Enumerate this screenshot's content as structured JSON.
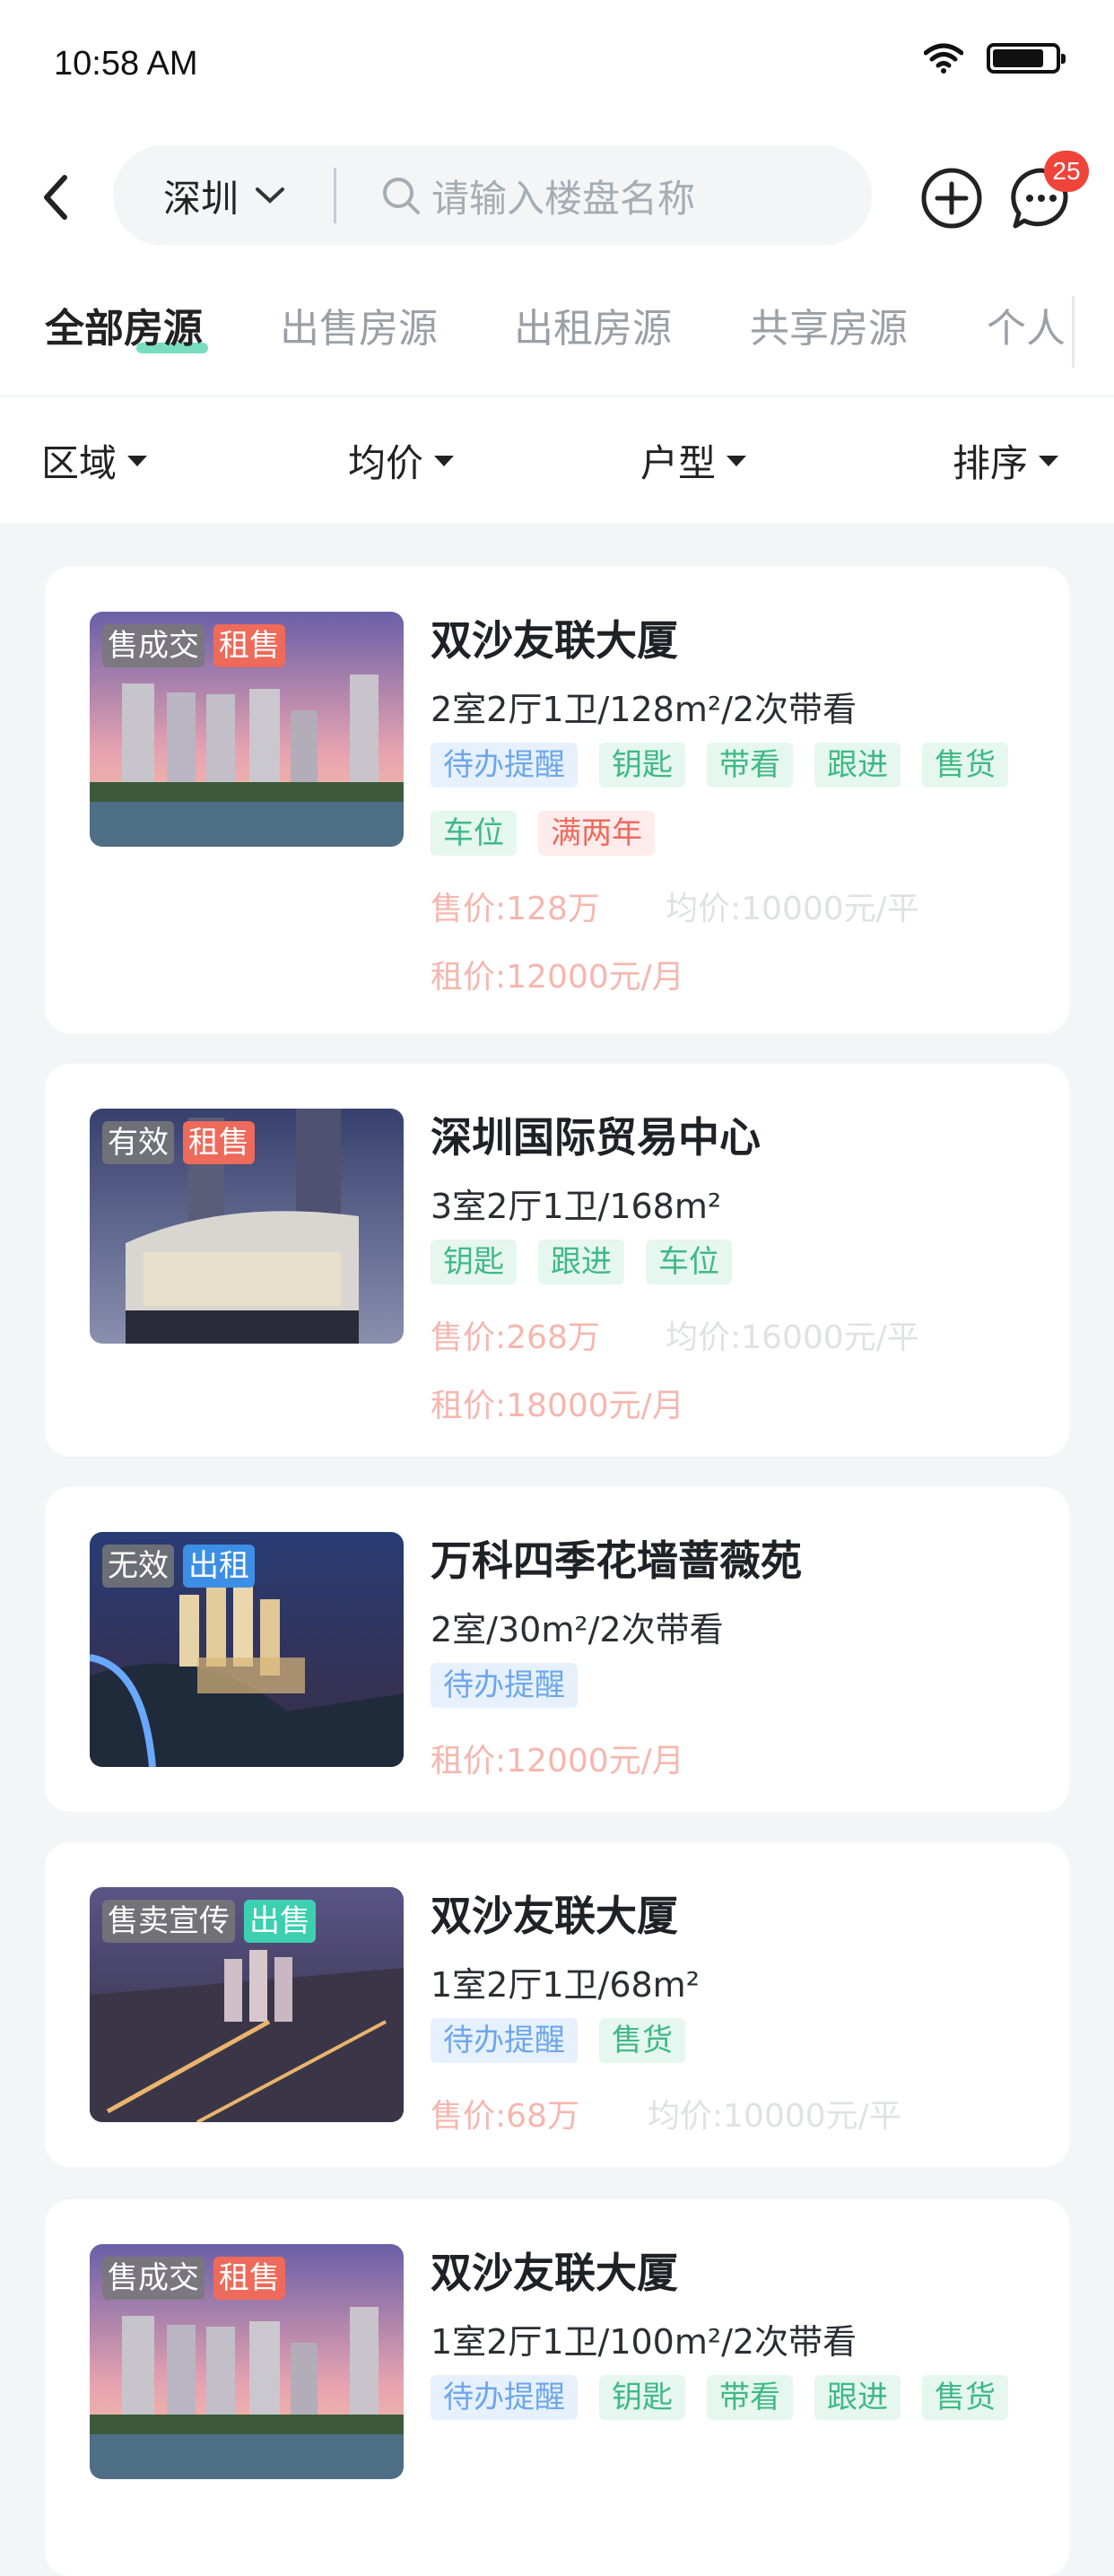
{
  "status": {
    "time": "10:58 AM"
  },
  "header": {
    "city": "深圳",
    "search_placeholder": "请输入楼盘名称",
    "message_badge": "25"
  },
  "tabs": [
    "全部房源",
    "出售房源",
    "出租房源",
    "共享房源",
    "个人"
  ],
  "filters": [
    "区域",
    "均价",
    "户型",
    "排序"
  ],
  "colors": {
    "accent": "#58d5b0",
    "badge": "#f0443a"
  },
  "listings": [
    {
      "status_tag": "售成交",
      "type_tag": "租售",
      "title": "双沙友联大厦",
      "spec": "2室2厅1卫/128m²/2次带看",
      "tags_row1": [
        "待办提醒",
        "钥匙",
        "带看",
        "跟进",
        "售货"
      ],
      "tags_row2": [
        "车位",
        "满两年"
      ],
      "sale_price": "售价:128万",
      "avg_price": "均价:10000元/平",
      "rent_price": "租价:12000元/月"
    },
    {
      "status_tag": "有效",
      "type_tag": "租售",
      "title": "深圳国际贸易中心",
      "spec": "3室2厅1卫/168m²",
      "tags_row1": [
        "钥匙",
        "跟进",
        "车位"
      ],
      "sale_price": "售价:268万",
      "avg_price": "均价:16000元/平",
      "rent_price": "租价:18000元/月"
    },
    {
      "status_tag": "无效",
      "type_tag": "出租",
      "title": "万科四季花墙蔷薇苑",
      "spec": "2室/30m²/2次带看",
      "tags_row1": [
        "待办提醒"
      ],
      "rent_price": "租价:12000元/月"
    },
    {
      "status_tag": "售卖宣传",
      "type_tag": "出售",
      "title": "双沙友联大厦",
      "spec": "1室2厅1卫/68m²",
      "tags_row1": [
        "待办提醒",
        "售货"
      ],
      "sale_price": "售价:68万",
      "avg_price": "均价:10000元/平"
    },
    {
      "status_tag": "售成交",
      "type_tag": "租售",
      "title": "双沙友联大厦",
      "spec": "1室2厅1卫/100m²/2次带看",
      "tags_row1": [
        "待办提醒",
        "钥匙",
        "带看",
        "跟进",
        "售货"
      ]
    }
  ]
}
